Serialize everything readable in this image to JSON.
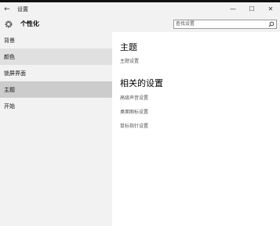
{
  "window": {
    "title": "设置",
    "back_glyph": "←",
    "controls": {
      "minimize": "—",
      "maximize": "☐",
      "close": "✕"
    }
  },
  "header": {
    "title": "个性化",
    "icon": "gear-icon",
    "search": {
      "value": "",
      "placeholder": "查找设置",
      "icon": "search-icon"
    }
  },
  "sidebar": {
    "items": [
      {
        "label": "背景",
        "state": "normal"
      },
      {
        "label": "颜色",
        "state": "hover"
      },
      {
        "label": "锁屏界面",
        "state": "normal"
      },
      {
        "label": "主题",
        "state": "selected"
      },
      {
        "label": "开始",
        "state": "normal"
      }
    ]
  },
  "main": {
    "section_title": "主题",
    "theme_settings_link": "主题设置",
    "related_title": "相关的设置",
    "related_links": [
      "高级声音设置",
      "桌面图标设置",
      "鼠标指针设置"
    ]
  },
  "colors": {
    "sidebar_bg": "#f2f2f2",
    "selected_bg": "#cccccc",
    "hover_bg": "#e0e0e0"
  }
}
